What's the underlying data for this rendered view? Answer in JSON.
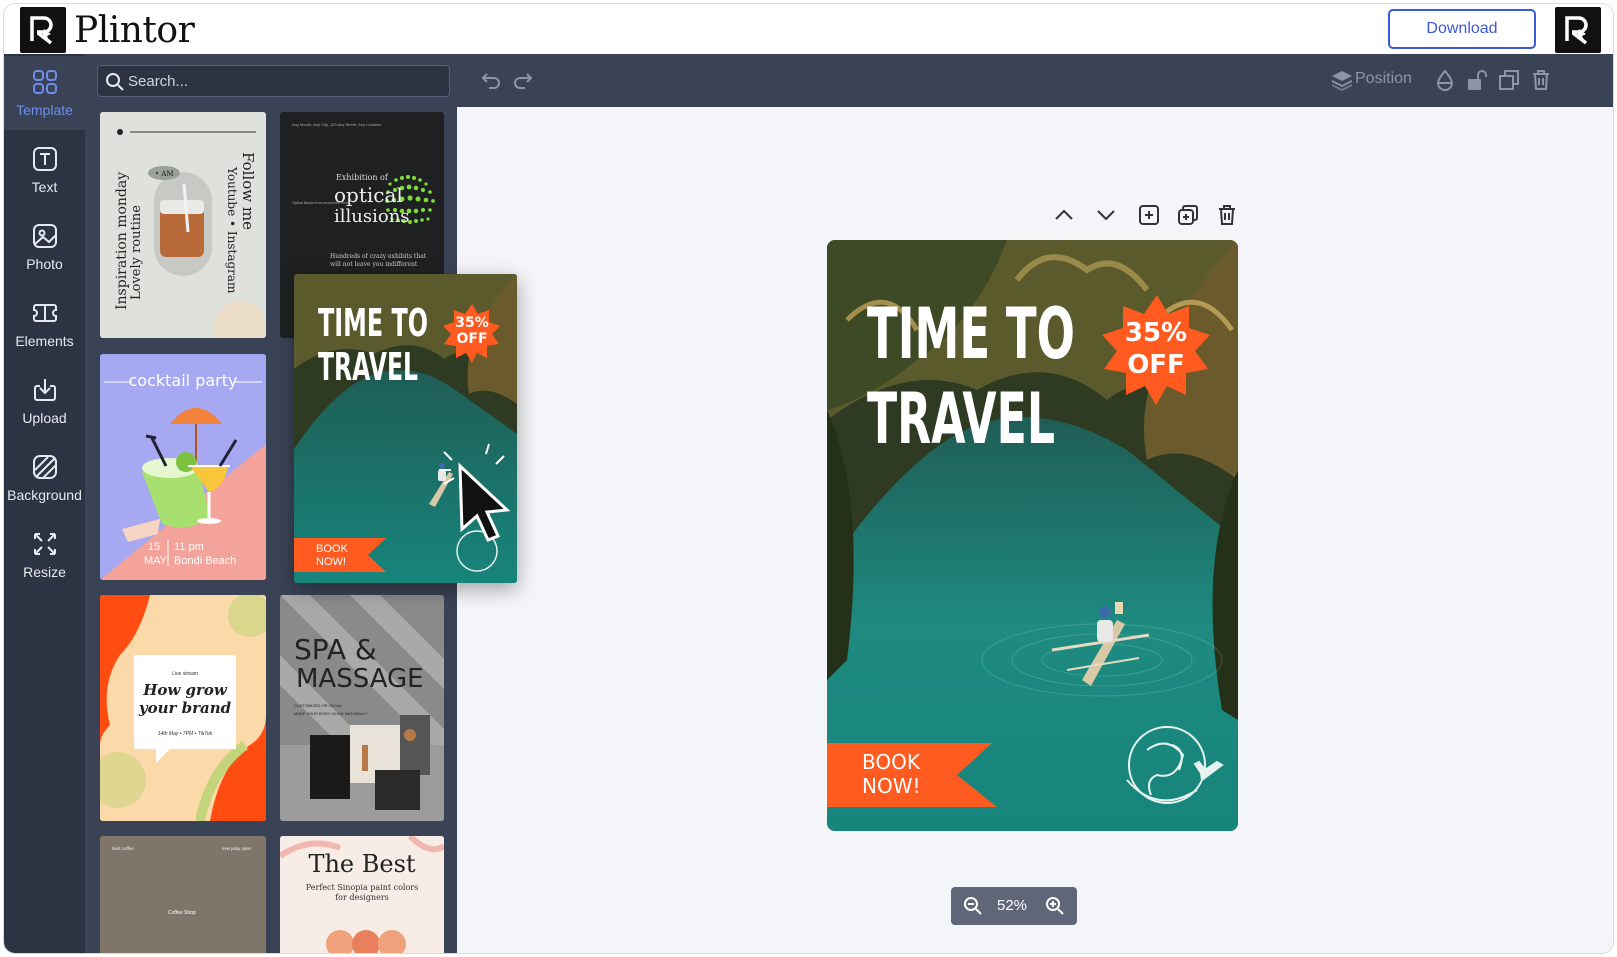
{
  "app": {
    "brand": "Plintor",
    "download_label": "Download"
  },
  "nav": {
    "items": [
      {
        "label": "Template",
        "icon": "grid-icon",
        "active": true
      },
      {
        "label": "Text",
        "icon": "text-icon"
      },
      {
        "label": "Photo",
        "icon": "photo-icon"
      },
      {
        "label": "Elements",
        "icon": "elements-icon"
      },
      {
        "label": "Upload",
        "icon": "upload-icon"
      },
      {
        "label": "Background",
        "icon": "background-icon"
      },
      {
        "label": "Resize",
        "icon": "resize-icon"
      }
    ]
  },
  "search": {
    "placeholder": "Search..."
  },
  "templates": {
    "t1": {
      "line1": "Inspiration monday",
      "line2": "Lovely routine",
      "side": "Follow me",
      "side2": "Youtube • Instagram",
      "tag": "• AM"
    },
    "t2": {
      "header": "Any Month, Any City, 123 Any Street, Any Location",
      "title_small": "Exhibition of",
      "title1": "optical",
      "title2": "illusions",
      "side": "Optical illusion from around the world",
      "footer1": "Hundreds of crazy exhibits that",
      "footer2": "will not leave you indifferent"
    },
    "t3": {
      "title": "cocktail party",
      "day": "15",
      "month": "MAY",
      "time": "11 pm",
      "place": "Bondi Beach"
    },
    "t4": {
      "top": "Live stream",
      "title1": "How grow",
      "title2": "your brand",
      "date": "14th May • 7PM • TikTok"
    },
    "t5": {
      "title1": "SPA &",
      "title2": "MASSAGE",
      "sub1": "CUSTOMIZED OR FACIAL",
      "sub2": "MAKE YOUR BODY GLOW NATURALLY"
    },
    "t6": {
      "left": "best coffee",
      "right": "everyday open",
      "center": "Coffee Shop"
    },
    "t7": {
      "title": "The Best",
      "sub1": "Perfect Sinopia paint colors",
      "sub2": "for designers"
    }
  },
  "design": {
    "headline1": "TIME TO",
    "headline2": "TRAVEL",
    "badge_pct": "35%",
    "badge_off": "OFF",
    "cta1": "BOOK",
    "cta2": "NOW!"
  },
  "toolbar": {
    "position_label": "Position"
  },
  "zoom": {
    "value": "52%"
  },
  "colors": {
    "accent": "#3b5ad9",
    "nav_bg": "#2c3443",
    "panel_bg": "#3a4356",
    "orange": "#ff5a1f"
  }
}
